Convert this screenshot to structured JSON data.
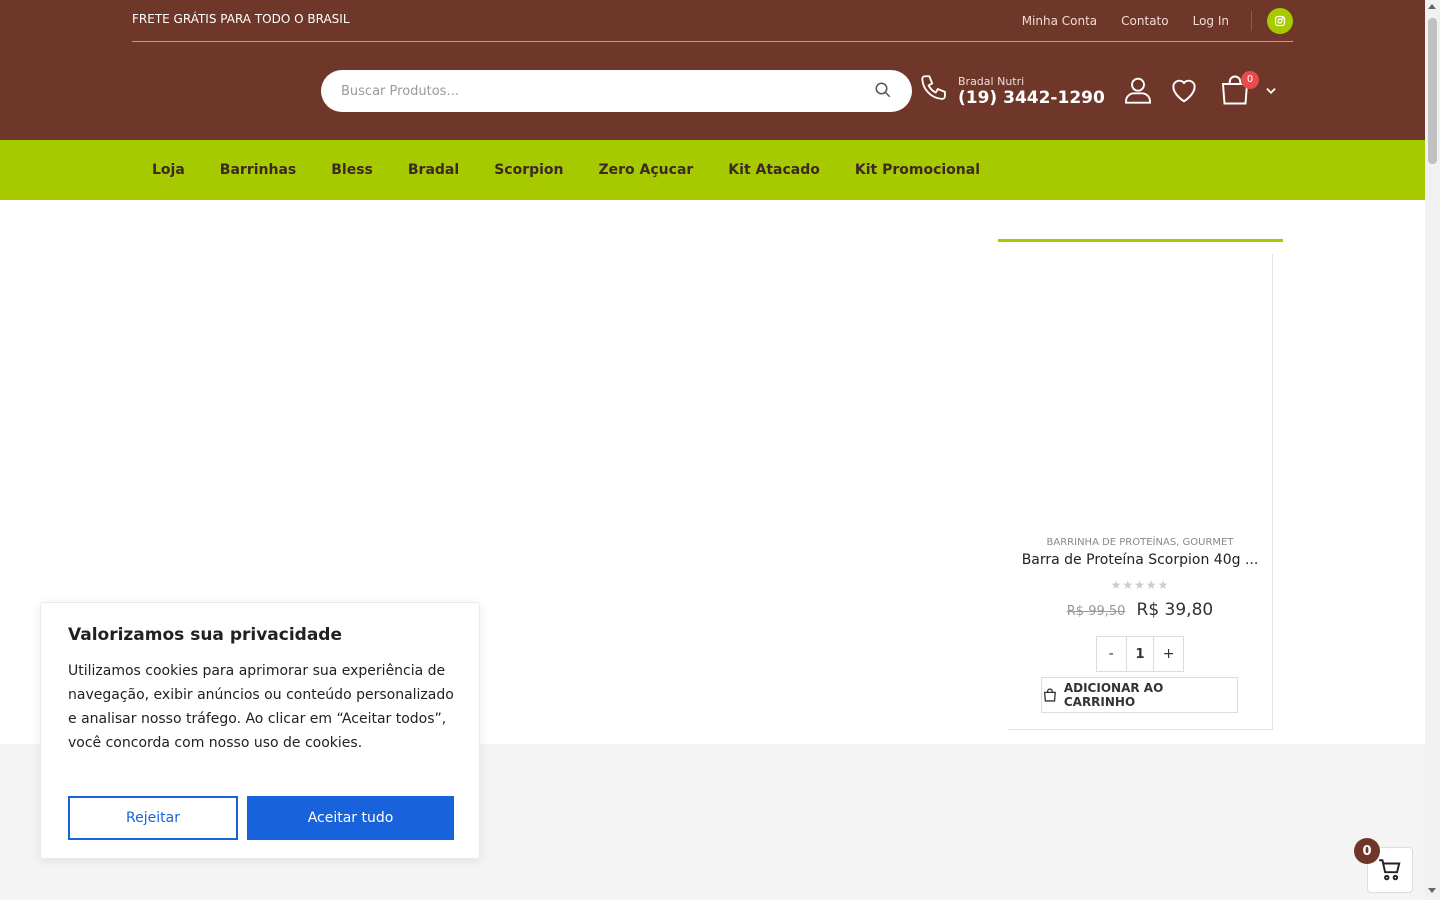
{
  "topbar": {
    "shipping": "FRETE GRÁTIS PARA TODO O BRASIL",
    "links": [
      "Minha Conta",
      "Contato",
      "Log In"
    ],
    "instagram_icon": "instagram-icon"
  },
  "search": {
    "placeholder": "Buscar Produtos..."
  },
  "contact": {
    "label": "Bradal Nutri",
    "phone": "(19) 3442-1290"
  },
  "cart": {
    "count": "0"
  },
  "nav": {
    "items": [
      "Loja",
      "Barrinhas",
      "Bless",
      "Bradal",
      "Scorpion",
      "Zero Açucar",
      "Kit Atacado",
      "Kit Promocional"
    ]
  },
  "product": {
    "categories": "BARRINHA DE PROTEÍNAS, GOURMET",
    "name": "Barra de Proteína Scorpion 40g ...",
    "rating": 0,
    "old_price": "R$ 99,50",
    "new_price": "R$ 39,80",
    "qty_minus": "-",
    "qty": "1",
    "qty_plus": "+",
    "add_to_cart": "ADICIONAR AO CARRINHO"
  },
  "cookie": {
    "title": "Valorizamos sua privacidade",
    "body": "Utilizamos cookies para aprimorar sua experiência de navegação, exibir anúncios ou conteúdo personalizado e analisar nosso tráfego. Ao clicar em “Aceitar todos”, você concorda com nosso uso de cookies.",
    "reject": "Rejeitar",
    "accept": "Aceitar tudo"
  },
  "floating_cart": {
    "count": "0"
  },
  "colors": {
    "header_brown": "#6e3729",
    "nav_green": "#a6c900",
    "accent_blue": "#1863dc",
    "badge_red": "#e84b4b"
  }
}
